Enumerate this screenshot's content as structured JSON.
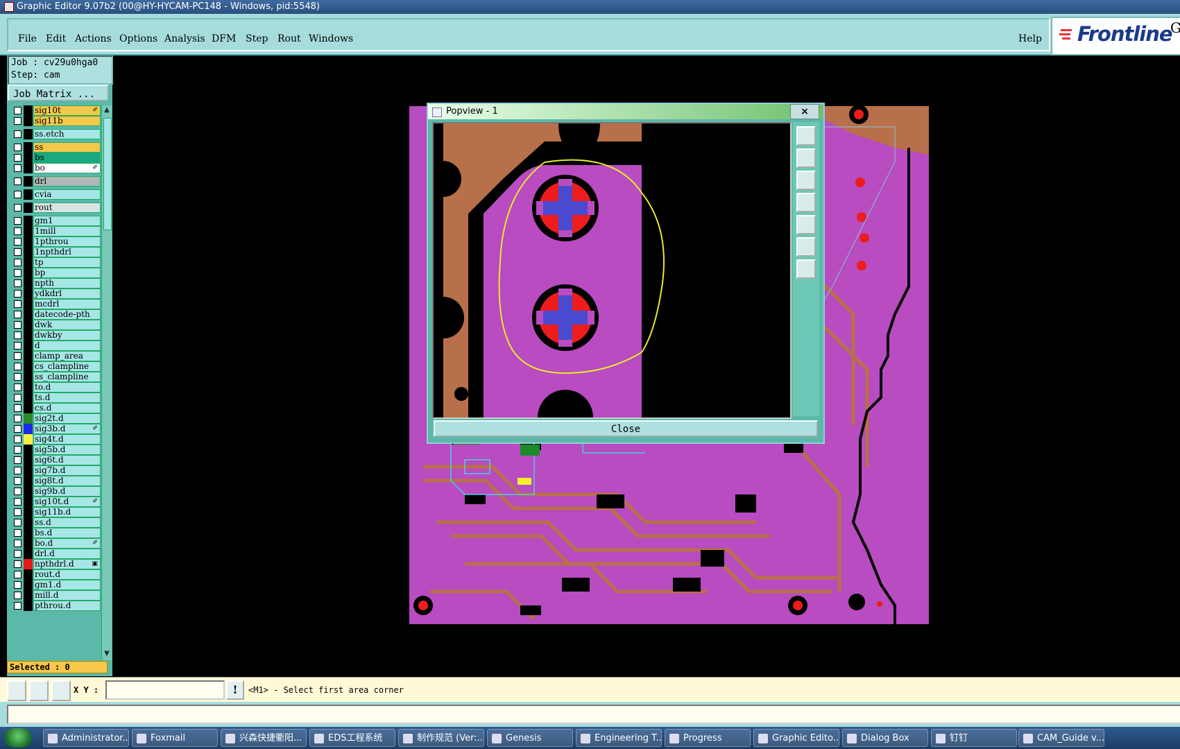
{
  "window": {
    "title": "Graphic Editor 9.07b2 (00@HY-HYCAM-PC148 - Windows, pid:5548)"
  },
  "menu": {
    "items": [
      "File",
      "Edit",
      "Actions",
      "Options",
      "Analysis",
      "DFM",
      "Step",
      "Rout",
      "Windows"
    ],
    "help": "Help"
  },
  "logo": {
    "text": "Frontline",
    "suffix": "G"
  },
  "job": {
    "job_line": "Job : cv29u0hga0",
    "step_line": "Step: cam",
    "matrix_button": "Job Matrix ..."
  },
  "layers": [
    {
      "name": "sig10t",
      "color": "#f5c74a",
      "mark": "✐",
      "swatch": "#000"
    },
    {
      "name": "sig11b",
      "color": "#f5c74a",
      "mark": "",
      "swatch": "#000"
    },
    {
      "name": "ss.etch",
      "color": "#a6e6e6",
      "mark": "",
      "swatch": "#000"
    },
    {
      "name": "ss",
      "color": "#f5c74a",
      "mark": "",
      "swatch": "#000"
    },
    {
      "name": "bs",
      "color": "#1aa880",
      "mark": "",
      "swatch": "#000"
    },
    {
      "name": "bo",
      "color": "#ffffff",
      "mark": "✐",
      "swatch": "#000"
    },
    {
      "name": "drl",
      "color": "#b0b8b8",
      "mark": "",
      "swatch": "#000"
    },
    {
      "name": "cvia",
      "color": "#a6e6e6",
      "mark": "",
      "swatch": "#000"
    },
    {
      "name": "rout",
      "color": "#d8e4e0",
      "mark": "",
      "swatch": "#000"
    },
    {
      "name": "gm1",
      "color": "#a6e6e6",
      "mark": "",
      "swatch": "#000"
    },
    {
      "name": "1mill",
      "color": "#a6e6e6",
      "mark": "",
      "swatch": "#000"
    },
    {
      "name": "1pthrou",
      "color": "#a6e6e6",
      "mark": "",
      "swatch": "#000"
    },
    {
      "name": "1npthdrl",
      "color": "#a6e6e6",
      "mark": "",
      "swatch": "#000"
    },
    {
      "name": "tp",
      "color": "#a6e6e6",
      "mark": "",
      "swatch": "#000"
    },
    {
      "name": "bp",
      "color": "#a6e6e6",
      "mark": "",
      "swatch": "#000"
    },
    {
      "name": "npth",
      "color": "#a6e6e6",
      "mark": "",
      "swatch": "#000"
    },
    {
      "name": "ydkdrl",
      "color": "#a6e6e6",
      "mark": "",
      "swatch": "#000"
    },
    {
      "name": "mcdrl",
      "color": "#a6e6e6",
      "mark": "",
      "swatch": "#000"
    },
    {
      "name": "datecode-pth",
      "color": "#a6e6e6",
      "mark": "",
      "swatch": "#000"
    },
    {
      "name": "dwk",
      "color": "#a6e6e6",
      "mark": "",
      "swatch": "#000"
    },
    {
      "name": "dwkby",
      "color": "#a6e6e6",
      "mark": "",
      "swatch": "#000"
    },
    {
      "name": "d",
      "color": "#a6e6e6",
      "mark": "",
      "swatch": "#000"
    },
    {
      "name": "clamp_area",
      "color": "#a6e6e6",
      "mark": "",
      "swatch": "#000"
    },
    {
      "name": "cs_clampline",
      "color": "#a6e6e6",
      "mark": "",
      "swatch": "#000"
    },
    {
      "name": "ss_clampline",
      "color": "#a6e6e6",
      "mark": "",
      "swatch": "#000"
    },
    {
      "name": "to.d",
      "color": "#a6e6e6",
      "mark": "",
      "swatch": "#000"
    },
    {
      "name": "ts.d",
      "color": "#a6e6e6",
      "mark": "",
      "swatch": "#000"
    },
    {
      "name": "cs.d",
      "color": "#a6e6e6",
      "mark": "",
      "swatch": "#000"
    },
    {
      "name": "sig2t.d",
      "color": "#a6e6e6",
      "mark": "",
      "swatch": "#2a8a2a"
    },
    {
      "name": "sig3b.d",
      "color": "#a6e6e6",
      "mark": "✐",
      "swatch": "#1a2ae6"
    },
    {
      "name": "sig4t.d",
      "color": "#a6e6e6",
      "mark": "",
      "swatch": "#f5f040"
    },
    {
      "name": "sig5b.d",
      "color": "#a6e6e6",
      "mark": "",
      "swatch": "#000"
    },
    {
      "name": "sig6t.d",
      "color": "#a6e6e6",
      "mark": "",
      "swatch": "#000"
    },
    {
      "name": "sig7b.d",
      "color": "#a6e6e6",
      "mark": "",
      "swatch": "#000"
    },
    {
      "name": "sig8t.d",
      "color": "#a6e6e6",
      "mark": "",
      "swatch": "#000"
    },
    {
      "name": "sig9b.d",
      "color": "#a6e6e6",
      "mark": "",
      "swatch": "#000"
    },
    {
      "name": "sig10t.d",
      "color": "#a6e6e6",
      "mark": "✐",
      "swatch": "#000"
    },
    {
      "name": "sig11b.d",
      "color": "#a6e6e6",
      "mark": "",
      "swatch": "#000"
    },
    {
      "name": "ss.d",
      "color": "#a6e6e6",
      "mark": "",
      "swatch": "#000"
    },
    {
      "name": "bs.d",
      "color": "#a6e6e6",
      "mark": "",
      "swatch": "#000"
    },
    {
      "name": "bo.d",
      "color": "#a6e6e6",
      "mark": "✐",
      "swatch": "#000"
    },
    {
      "name": "drl.d",
      "color": "#a6e6e6",
      "mark": "",
      "swatch": "#000"
    },
    {
      "name": "npthdrl.d",
      "color": "#a6e6e6",
      "mark": "▣",
      "swatch": "#e61a1a"
    },
    {
      "name": "rout.d",
      "color": "#a6e6e6",
      "mark": "",
      "swatch": "#000"
    },
    {
      "name": "gm1.d",
      "color": "#a6e6e6",
      "mark": "",
      "swatch": "#000"
    },
    {
      "name": "mill.d",
      "color": "#a6e6e6",
      "mark": "",
      "swatch": "#000"
    },
    {
      "name": "pthrou.d",
      "color": "#a6e6e6",
      "mark": "",
      "swatch": "#000"
    }
  ],
  "selected": "Selected : 0",
  "command": {
    "xy_label": "X Y :",
    "xy_value": "",
    "bang": "!",
    "prompt": "<M1> - Select first area corner"
  },
  "popview": {
    "title": "Popview - 1",
    "close_x": "×",
    "close_button": "Close"
  },
  "taskbar": [
    {
      "label": "Administrator..."
    },
    {
      "label": "Foxmail"
    },
    {
      "label": "兴森快捷衢阳..."
    },
    {
      "label": "EDS工程系统"
    },
    {
      "label": "制作规范 (Ver:..."
    },
    {
      "label": "Genesis"
    },
    {
      "label": "Engineering T..."
    },
    {
      "label": "Progress"
    },
    {
      "label": "Graphic Edito..."
    },
    {
      "label": "Dialog Box"
    },
    {
      "label": "钉钉"
    },
    {
      "label": "CAM_Guide v..."
    }
  ],
  "colors": {
    "panel": "#5ab9a8",
    "menu": "#a6dcdc",
    "board": "#b84cc0",
    "copper": "#b8704a",
    "pad_red": "#ee1c1c",
    "pad_blue": "#4a4ad0",
    "outline_yellow": "#e8e830"
  }
}
